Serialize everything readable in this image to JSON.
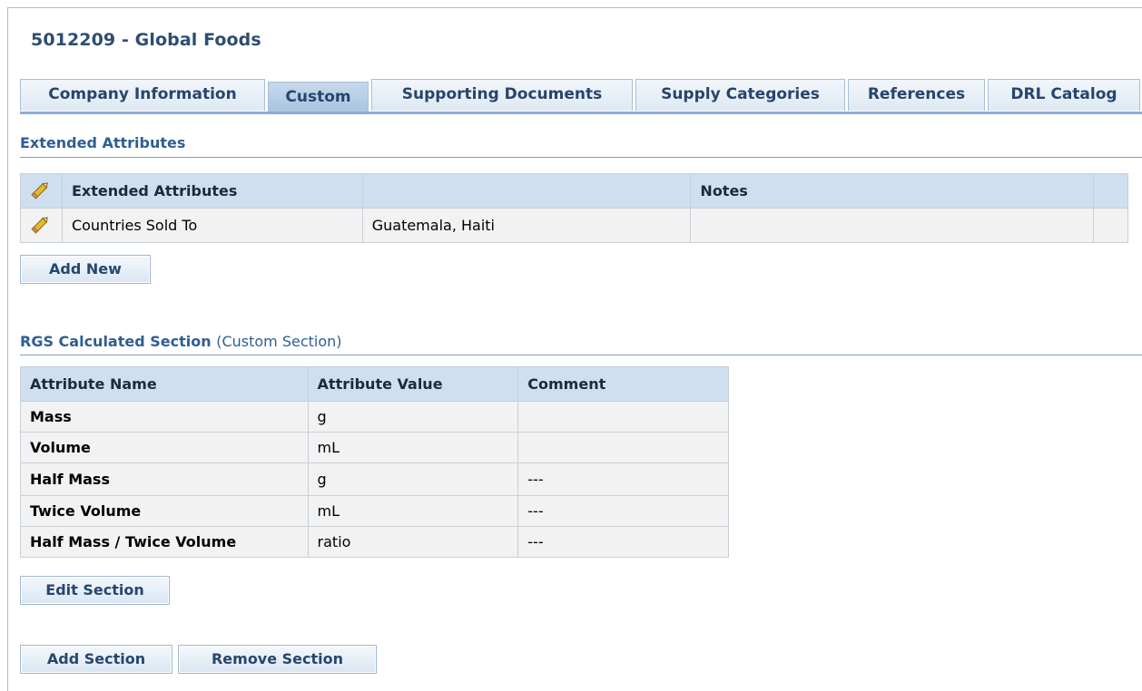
{
  "page": {
    "title": "5012209 - Global Foods"
  },
  "tabs": [
    {
      "label": "Company Information",
      "active": false
    },
    {
      "label": "Custom",
      "active": true
    },
    {
      "label": "Supporting Documents",
      "active": false
    },
    {
      "label": "Supply Categories",
      "active": false
    },
    {
      "label": "References",
      "active": false
    },
    {
      "label": "DRL Catalog",
      "active": false
    }
  ],
  "extended": {
    "heading": "Extended Attributes",
    "columns": [
      "Extended Attributes",
      "",
      "Notes",
      ""
    ],
    "rows": [
      {
        "attribute": "Countries Sold To",
        "value": "Guatemala, Haiti",
        "notes": ""
      }
    ],
    "add_new_label": "Add New"
  },
  "rgs": {
    "heading": "RGS Calculated Section",
    "heading_suffix": "(Custom Section)",
    "columns": [
      "Attribute Name",
      "Attribute Value",
      "Comment"
    ],
    "rows": [
      {
        "name": "Mass",
        "value": "g",
        "comment": ""
      },
      {
        "name": "Volume",
        "value": "mL",
        "comment": ""
      },
      {
        "name": "Half Mass",
        "value": "g",
        "comment": "---"
      },
      {
        "name": "Twice Volume",
        "value": "mL",
        "comment": "---"
      },
      {
        "name": "Half Mass / Twice Volume",
        "value": "ratio",
        "comment": "---"
      }
    ],
    "edit_section_label": "Edit Section"
  },
  "actions": {
    "add_section_label": "Add Section",
    "remove_section_label": "Remove Section"
  },
  "colors": {
    "tab_active": "#a9c4de",
    "header_bg": "#cfdff0",
    "heading_text": "#2f5e93"
  },
  "icons": {
    "edit": "pencil-icon"
  }
}
